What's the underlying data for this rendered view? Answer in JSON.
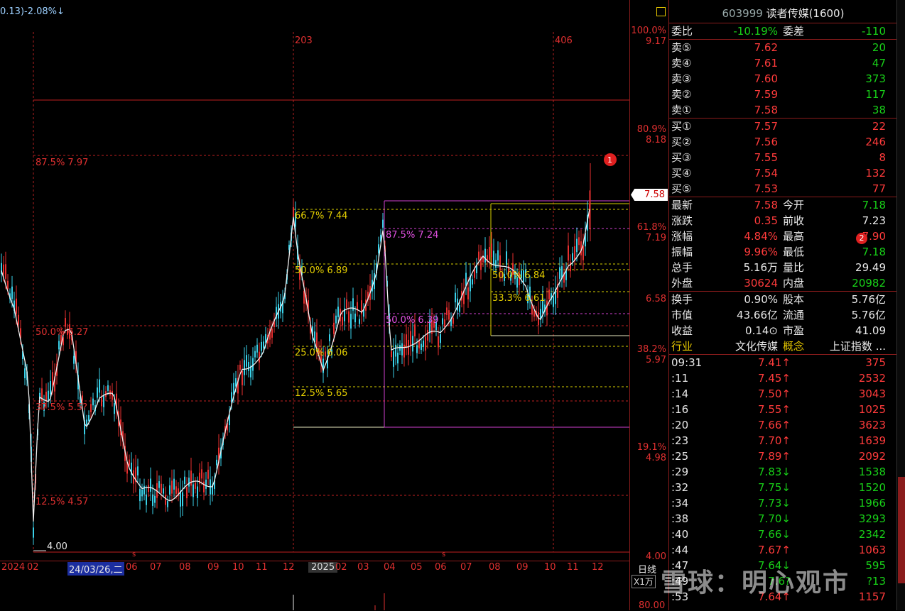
{
  "top_info": "0.13)-2.08%↓",
  "stock": {
    "code": "603999",
    "name": "读者传媒",
    "suffix": "(1600)"
  },
  "current_price_tag": "7.58",
  "axis_labels": [
    "100.0%",
    "9.17",
    "80.9%",
    "8.18",
    "61.8%",
    "7.19",
    "6.58",
    "38.2%",
    "5.97",
    "19.1%",
    "4.98",
    "4.00",
    "80.00"
  ],
  "timeline": {
    "items": [
      "2024",
      "02",
      "24/03/26,二",
      "06",
      "07",
      "08",
      "09",
      "10",
      "11",
      "12",
      "2025",
      "02",
      "03",
      "04",
      "05",
      "06",
      "07",
      "08",
      "09",
      "10",
      "11",
      "12"
    ],
    "period": "日线",
    "volume_unit": "X1万"
  },
  "markers": {
    "m203": "203",
    "m406": "406",
    "low_label": "4.00",
    "badge1": "1",
    "badge2": "2"
  },
  "fib_left": [
    "87.5% 7.97",
    "50.0% 6.27",
    "37.5% 5.5?",
    "12.5% 4.57"
  ],
  "fib_mid": [
    "66.7% 7.44",
    "50.0% 6.89",
    "25.0% 6.06",
    "12.5% 5.65"
  ],
  "fib_magenta": [
    "87.5% 7.24",
    "50.0% 6.39"
  ],
  "fib_right": [
    "50.0% 6.84",
    "33.3% 6.61"
  ],
  "panel": {
    "weibi": {
      "label": "委比",
      "value": "-10.19%",
      "label2": "委差",
      "value2": "-110"
    },
    "asks": [
      {
        "label": "卖⑤",
        "price": "7.62",
        "vol": "20"
      },
      {
        "label": "卖④",
        "price": "7.61",
        "vol": "47"
      },
      {
        "label": "卖③",
        "price": "7.60",
        "vol": "373"
      },
      {
        "label": "卖②",
        "price": "7.59",
        "vol": "117"
      },
      {
        "label": "卖①",
        "price": "7.58",
        "vol": "38"
      }
    ],
    "bids": [
      {
        "label": "买①",
        "price": "7.57",
        "vol": "22"
      },
      {
        "label": "买②",
        "price": "7.56",
        "vol": "246"
      },
      {
        "label": "买③",
        "price": "7.55",
        "vol": "8"
      },
      {
        "label": "买④",
        "price": "7.54",
        "vol": "132"
      },
      {
        "label": "买⑤",
        "price": "7.53",
        "vol": "77"
      }
    ],
    "stats": [
      {
        "l1": "最新",
        "v1": "7.58",
        "c1": "red",
        "l2": "今开",
        "v2": "7.18",
        "c2": "grn"
      },
      {
        "l1": "涨跌",
        "v1": "0.35",
        "c1": "red",
        "l2": "前收",
        "v2": "7.23",
        "c2": "wht"
      },
      {
        "l1": "涨幅",
        "v1": "4.84%",
        "c1": "red",
        "l2": "最高",
        "v2": "7.90",
        "c2": "red"
      },
      {
        "l1": "振幅",
        "v1": "9.96%",
        "c1": "red",
        "l2": "最低",
        "v2": "7.18",
        "c2": "grn"
      },
      {
        "l1": "总手",
        "v1": "5.16万",
        "c1": "wht",
        "l2": "量比",
        "v2": "29.49",
        "c2": "wht"
      },
      {
        "l1": "外盘",
        "v1": "30624",
        "c1": "red",
        "l2": "内盘",
        "v2": "20982",
        "c2": "grn"
      }
    ],
    "fund": [
      {
        "l1": "换手",
        "v1": "0.90%",
        "l2": "股本",
        "v2": "5.76亿"
      },
      {
        "l1": "市值",
        "v1": "43.66亿",
        "l2": "流通",
        "v2": "5.76亿"
      },
      {
        "l1": "收益",
        "v1": "0.14⊙",
        "l2": "市盈",
        "v2": "41.09"
      }
    ],
    "industry": {
      "l1": "行业",
      "v1": "文化传媒",
      "l2": "概念",
      "v2": "上证指数 ..."
    },
    "ticks": [
      {
        "t": "09:31",
        "p": "7.41↑",
        "pc": "red",
        "v": "375",
        "vc": "red"
      },
      {
        "t": ":11",
        "p": "7.45↑",
        "pc": "red",
        "v": "2532",
        "vc": "red"
      },
      {
        "t": ":14",
        "p": "7.50↑",
        "pc": "red",
        "v": "3043",
        "vc": "red"
      },
      {
        "t": ":16",
        "p": "7.55↑",
        "pc": "red",
        "v": "1025",
        "vc": "red"
      },
      {
        "t": ":20",
        "p": "7.66↑",
        "pc": "red",
        "v": "3623",
        "vc": "red"
      },
      {
        "t": ":23",
        "p": "7.70↑",
        "pc": "red",
        "v": "1639",
        "vc": "red"
      },
      {
        "t": ":25",
        "p": "7.89↑",
        "pc": "red",
        "v": "2092",
        "vc": "red"
      },
      {
        "t": ":29",
        "p": "7.83↓",
        "pc": "grn",
        "v": "1538",
        "vc": "grn"
      },
      {
        "t": ":32",
        "p": "7.75↓",
        "pc": "grn",
        "v": "1520",
        "vc": "grn"
      },
      {
        "t": ":34",
        "p": "7.73↓",
        "pc": "grn",
        "v": "1966",
        "vc": "grn"
      },
      {
        "t": ":38",
        "p": "7.70↓",
        "pc": "grn",
        "v": "3293",
        "vc": "grn"
      },
      {
        "t": ":40",
        "p": "7.66↓",
        "pc": "grn",
        "v": "2342",
        "vc": "grn"
      },
      {
        "t": ":44",
        "p": "7.67↑",
        "pc": "red",
        "v": "1063",
        "vc": "red"
      },
      {
        "t": ":47",
        "p": "7.64↓",
        "pc": "grn",
        "v": "595",
        "vc": "grn"
      },
      {
        "t": ":49",
        "p": "7.6?",
        "pc": "grn",
        "v": "?13",
        "vc": "grn"
      },
      {
        "t": ":53",
        "p": "7.64↑",
        "pc": "red",
        "v": "1157",
        "vc": "red"
      }
    ]
  },
  "watermark": "雪球：明心观市"
}
